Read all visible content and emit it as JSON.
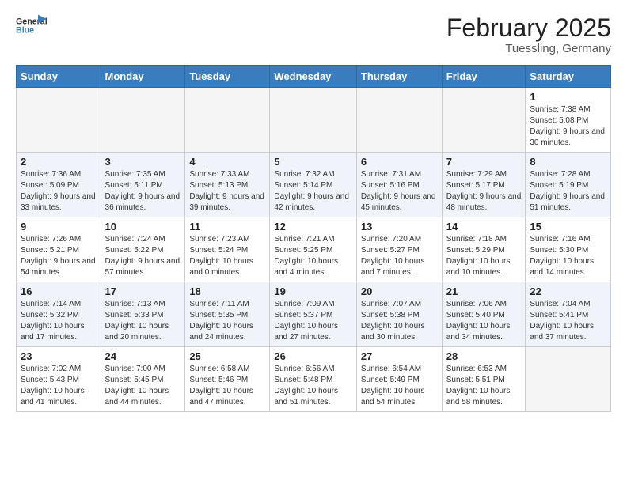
{
  "header": {
    "logo_general": "General",
    "logo_blue": "Blue",
    "month": "February 2025",
    "location": "Tuessling, Germany"
  },
  "days_of_week": [
    "Sunday",
    "Monday",
    "Tuesday",
    "Wednesday",
    "Thursday",
    "Friday",
    "Saturday"
  ],
  "weeks": [
    [
      {
        "day": "",
        "info": ""
      },
      {
        "day": "",
        "info": ""
      },
      {
        "day": "",
        "info": ""
      },
      {
        "day": "",
        "info": ""
      },
      {
        "day": "",
        "info": ""
      },
      {
        "day": "",
        "info": ""
      },
      {
        "day": "1",
        "info": "Sunrise: 7:38 AM\nSunset: 5:08 PM\nDaylight: 9 hours and 30 minutes."
      }
    ],
    [
      {
        "day": "2",
        "info": "Sunrise: 7:36 AM\nSunset: 5:09 PM\nDaylight: 9 hours and 33 minutes."
      },
      {
        "day": "3",
        "info": "Sunrise: 7:35 AM\nSunset: 5:11 PM\nDaylight: 9 hours and 36 minutes."
      },
      {
        "day": "4",
        "info": "Sunrise: 7:33 AM\nSunset: 5:13 PM\nDaylight: 9 hours and 39 minutes."
      },
      {
        "day": "5",
        "info": "Sunrise: 7:32 AM\nSunset: 5:14 PM\nDaylight: 9 hours and 42 minutes."
      },
      {
        "day": "6",
        "info": "Sunrise: 7:31 AM\nSunset: 5:16 PM\nDaylight: 9 hours and 45 minutes."
      },
      {
        "day": "7",
        "info": "Sunrise: 7:29 AM\nSunset: 5:17 PM\nDaylight: 9 hours and 48 minutes."
      },
      {
        "day": "8",
        "info": "Sunrise: 7:28 AM\nSunset: 5:19 PM\nDaylight: 9 hours and 51 minutes."
      }
    ],
    [
      {
        "day": "9",
        "info": "Sunrise: 7:26 AM\nSunset: 5:21 PM\nDaylight: 9 hours and 54 minutes."
      },
      {
        "day": "10",
        "info": "Sunrise: 7:24 AM\nSunset: 5:22 PM\nDaylight: 9 hours and 57 minutes."
      },
      {
        "day": "11",
        "info": "Sunrise: 7:23 AM\nSunset: 5:24 PM\nDaylight: 10 hours and 0 minutes."
      },
      {
        "day": "12",
        "info": "Sunrise: 7:21 AM\nSunset: 5:25 PM\nDaylight: 10 hours and 4 minutes."
      },
      {
        "day": "13",
        "info": "Sunrise: 7:20 AM\nSunset: 5:27 PM\nDaylight: 10 hours and 7 minutes."
      },
      {
        "day": "14",
        "info": "Sunrise: 7:18 AM\nSunset: 5:29 PM\nDaylight: 10 hours and 10 minutes."
      },
      {
        "day": "15",
        "info": "Sunrise: 7:16 AM\nSunset: 5:30 PM\nDaylight: 10 hours and 14 minutes."
      }
    ],
    [
      {
        "day": "16",
        "info": "Sunrise: 7:14 AM\nSunset: 5:32 PM\nDaylight: 10 hours and 17 minutes."
      },
      {
        "day": "17",
        "info": "Sunrise: 7:13 AM\nSunset: 5:33 PM\nDaylight: 10 hours and 20 minutes."
      },
      {
        "day": "18",
        "info": "Sunrise: 7:11 AM\nSunset: 5:35 PM\nDaylight: 10 hours and 24 minutes."
      },
      {
        "day": "19",
        "info": "Sunrise: 7:09 AM\nSunset: 5:37 PM\nDaylight: 10 hours and 27 minutes."
      },
      {
        "day": "20",
        "info": "Sunrise: 7:07 AM\nSunset: 5:38 PM\nDaylight: 10 hours and 30 minutes."
      },
      {
        "day": "21",
        "info": "Sunrise: 7:06 AM\nSunset: 5:40 PM\nDaylight: 10 hours and 34 minutes."
      },
      {
        "day": "22",
        "info": "Sunrise: 7:04 AM\nSunset: 5:41 PM\nDaylight: 10 hours and 37 minutes."
      }
    ],
    [
      {
        "day": "23",
        "info": "Sunrise: 7:02 AM\nSunset: 5:43 PM\nDaylight: 10 hours and 41 minutes."
      },
      {
        "day": "24",
        "info": "Sunrise: 7:00 AM\nSunset: 5:45 PM\nDaylight: 10 hours and 44 minutes."
      },
      {
        "day": "25",
        "info": "Sunrise: 6:58 AM\nSunset: 5:46 PM\nDaylight: 10 hours and 47 minutes."
      },
      {
        "day": "26",
        "info": "Sunrise: 6:56 AM\nSunset: 5:48 PM\nDaylight: 10 hours and 51 minutes."
      },
      {
        "day": "27",
        "info": "Sunrise: 6:54 AM\nSunset: 5:49 PM\nDaylight: 10 hours and 54 minutes."
      },
      {
        "day": "28",
        "info": "Sunrise: 6:53 AM\nSunset: 5:51 PM\nDaylight: 10 hours and 58 minutes."
      },
      {
        "day": "",
        "info": ""
      }
    ]
  ]
}
